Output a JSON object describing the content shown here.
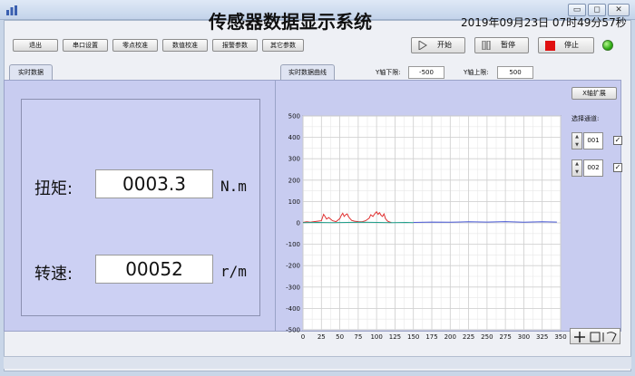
{
  "window": {
    "minimize_glyph": "▭",
    "maximize_glyph": "◻",
    "close_glyph": "✕"
  },
  "header": {
    "title": "传感器数据显示系统",
    "datetime": "2019年09月23日 07时49分57秒"
  },
  "toolbar": {
    "buttons": [
      "退出",
      "串口设置",
      "零点校准",
      "数值校准",
      "报警参数",
      "其它参数"
    ]
  },
  "controls": {
    "start": "开始",
    "pause": "暂停",
    "stop": "停止",
    "status_color": "#2fae14"
  },
  "tabs": {
    "left": "实时数据",
    "right": "实时数据曲线"
  },
  "realtime": {
    "torque_label": "扭矩:",
    "torque_value": "0003.3",
    "torque_unit": "N.m",
    "speed_label": "转速:",
    "speed_value": "00052",
    "speed_unit": "r/m"
  },
  "chart_controls": {
    "ymin_label": "Y轴下限:",
    "ymin_value": "-500",
    "ymax_label": "Y轴上限:",
    "ymax_value": "500",
    "x_expand": "X轴扩展",
    "select_channel_label": "选择通道:",
    "channels": [
      {
        "value": "001",
        "checked": true
      },
      {
        "value": "002",
        "checked": true
      }
    ]
  },
  "chart_data": {
    "type": "line",
    "xlim": [
      0,
      350
    ],
    "ylim": [
      -500,
      500
    ],
    "x_ticks": [
      0,
      25,
      50,
      75,
      100,
      125,
      150,
      175,
      200,
      225,
      250,
      275,
      300,
      325,
      350
    ],
    "y_ticks": [
      500,
      400,
      300,
      200,
      100,
      0,
      -100,
      -200,
      -300,
      -400,
      -500
    ],
    "grid": true,
    "series": [
      {
        "color": "#e03030",
        "x": [
          0,
          5,
          10,
          15,
          20,
          25,
          28,
          30,
          32,
          35,
          40,
          45,
          50,
          52,
          54,
          56,
          58,
          60,
          62,
          64,
          66,
          70,
          75,
          80,
          85,
          90,
          92,
          95,
          98,
          100,
          102,
          104,
          106,
          108,
          110,
          112,
          115,
          118,
          120
        ],
        "y": [
          2,
          5,
          3,
          6,
          8,
          10,
          40,
          30,
          18,
          25,
          10,
          6,
          20,
          35,
          45,
          30,
          38,
          42,
          28,
          20,
          12,
          8,
          6,
          5,
          10,
          22,
          38,
          30,
          45,
          52,
          40,
          48,
          36,
          30,
          42,
          20,
          8,
          4,
          2
        ]
      },
      {
        "color": "#4a5ad6",
        "x": [
          150,
          175,
          200,
          225,
          250,
          275,
          300,
          325,
          345
        ],
        "y": [
          2,
          4,
          3,
          5,
          4,
          6,
          3,
          5,
          4
        ]
      },
      {
        "color": "#1f9e8a",
        "x": [
          0,
          20,
          40,
          60,
          80,
          100,
          120,
          140,
          150
        ],
        "y": [
          1,
          2,
          1,
          2,
          3,
          2,
          1,
          2,
          1
        ]
      }
    ]
  },
  "icons": {
    "app": "chart-app-icon",
    "start": "play-icon",
    "pause": "pause-icon",
    "stop": "stop-icon",
    "chart_tools": "crosshair-zoom-icon"
  }
}
